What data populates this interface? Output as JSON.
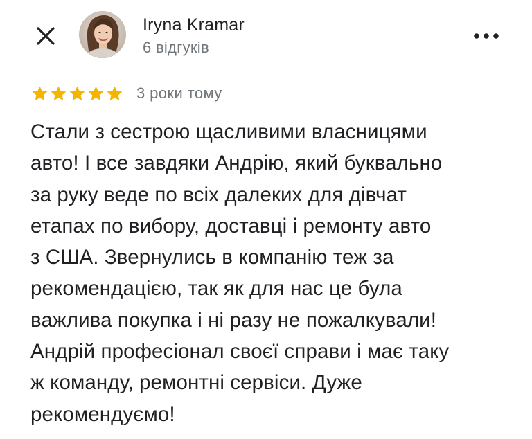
{
  "header": {
    "close_icon": "close-icon",
    "author_name": "Iryna Kramar",
    "author_reviews": "6 відгуків",
    "more_icon": "more-vertical-dots-icon"
  },
  "review": {
    "rating": 5,
    "rating_max": 5,
    "star_color": "#f4b400",
    "time_ago": "3 роки тому",
    "text": "Стали з сестрою щасливими власницями\nавто! І все завдяки Андрію, який буквально\nза руку веде по всіх далеких для дівчат\nетапах по вибору, доставці і  ремонту авто\nз США. Звернулись в компанію теж за\nрекомендацією, так як для нас це була\nважлива покупка і ні разу не пожалкували!\nАндрій професіонал своєї справи і має таку\nж команду, ремонтні сервіси. Дуже\nрекомендуємо!"
  }
}
